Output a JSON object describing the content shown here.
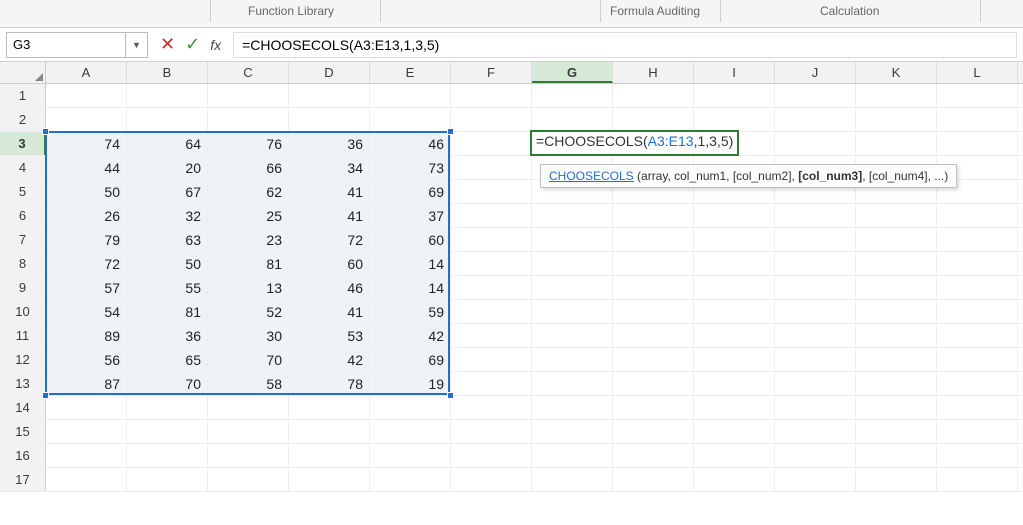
{
  "ribbon": {
    "group_library": "Function Library",
    "group_auditing": "Formula Auditing",
    "group_calculation": "Calculation"
  },
  "namebox": {
    "value": "G3"
  },
  "formula_bar": {
    "cancel": "✕",
    "enter": "✓",
    "fx": "fx",
    "formula": "=CHOOSECOLS(A3:E13,1,3,5)"
  },
  "columns": [
    "A",
    "B",
    "C",
    "D",
    "E",
    "F",
    "G",
    "H",
    "I",
    "J",
    "K",
    "L"
  ],
  "rows": [
    1,
    2,
    3,
    4,
    5,
    6,
    7,
    8,
    9,
    10,
    11,
    12,
    13,
    14,
    15,
    16,
    17
  ],
  "active": {
    "col": "G",
    "row": 3
  },
  "data": {
    "3": {
      "A": 74,
      "B": 64,
      "C": 76,
      "D": 36,
      "E": 46
    },
    "4": {
      "A": 44,
      "B": 20,
      "C": 66,
      "D": 34,
      "E": 73
    },
    "5": {
      "A": 50,
      "B": 67,
      "C": 62,
      "D": 41,
      "E": 69
    },
    "6": {
      "A": 26,
      "B": 32,
      "C": 25,
      "D": 41,
      "E": 37
    },
    "7": {
      "A": 79,
      "B": 63,
      "C": 23,
      "D": 72,
      "E": 60
    },
    "8": {
      "A": 72,
      "B": 50,
      "C": 81,
      "D": 60,
      "E": 14
    },
    "9": {
      "A": 57,
      "B": 55,
      "C": 13,
      "D": 46,
      "E": 14
    },
    "10": {
      "A": 54,
      "B": 81,
      "C": 52,
      "D": 41,
      "E": 59
    },
    "11": {
      "A": 89,
      "B": 36,
      "C": 30,
      "D": 53,
      "E": 42
    },
    "12": {
      "A": 56,
      "B": 65,
      "C": 70,
      "D": 42,
      "E": 69
    },
    "13": {
      "A": 87,
      "B": 70,
      "C": 58,
      "D": 78,
      "E": 19
    }
  },
  "active_formula": {
    "prefix": "=CHOOSECOLS(",
    "ref": "A3:E13",
    "suffix": ",1,3,5)"
  },
  "tooltip": {
    "fn": "CHOOSECOLS",
    "sig_prefix": " (array, col_num1, [col_num2], ",
    "sig_bold": "[col_num3]",
    "sig_suffix": ", [col_num4], ...)"
  }
}
